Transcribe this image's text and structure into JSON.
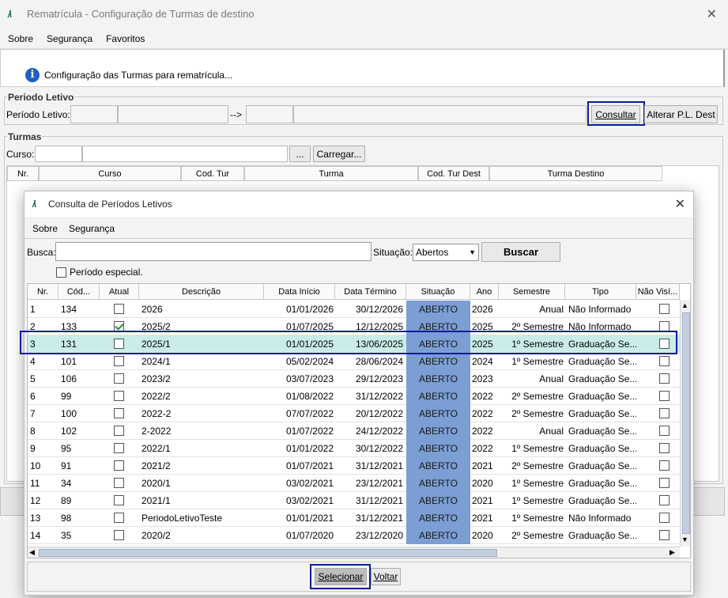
{
  "main": {
    "title": "Rematrícula - Configuração de Turmas de destino",
    "menu": [
      "Sobre",
      "Segurança",
      "Favoritos"
    ],
    "info": "Configuração das Turmas para rematrícula...",
    "periodo_group": "Periodo Letivo",
    "periodo_label": "Período Letivo:",
    "arrow": "-->",
    "consultar": "Consultar",
    "alterar": "Alterar P.L. Dest",
    "turmas_group": "Turmas",
    "curso_label": "Curso:",
    "ellipsis": "...",
    "carregar": "Carregar...",
    "columns": [
      "Nr.",
      "Curso",
      "Cod. Tur",
      "Turma",
      "Cod. Tur Dest",
      "Turma Destino"
    ]
  },
  "dialog": {
    "title": "Consulta de Períodos Letivos",
    "menu": [
      "Sobre",
      "Segurança"
    ],
    "busca_label": "Busca:",
    "busca_value": "",
    "situacao_label": "Situação:",
    "situacao_value": "Abertos",
    "buscar": "Buscar",
    "especial_label": "Período especial.",
    "columns": [
      "Nr.",
      "Cód...",
      "Atual",
      "Descrição",
      "Data Início",
      "Data Término",
      "Situação",
      "Ano",
      "Semestre",
      "Tipo",
      "Não Visí..."
    ],
    "rows": [
      {
        "nr": "1",
        "cod": "134",
        "atual": false,
        "desc": "2026",
        "ini": "01/01/2026",
        "fim": "30/12/2026",
        "sit": "ABERTO",
        "ano": "2026",
        "sem": "Anual",
        "tipo": "Não Informado"
      },
      {
        "nr": "2",
        "cod": "133",
        "atual": true,
        "desc": "2025/2",
        "ini": "01/07/2025",
        "fim": "12/12/2025",
        "sit": "ABERTO",
        "ano": "2025",
        "sem": "2º Semestre",
        "tipo": "Não Informado"
      },
      {
        "nr": "3",
        "cod": "131",
        "atual": false,
        "desc": "2025/1",
        "ini": "01/01/2025",
        "fim": "13/06/2025",
        "sit": "ABERTO",
        "ano": "2025",
        "sem": "1º Semestre",
        "tipo": "Graduação Se..."
      },
      {
        "nr": "4",
        "cod": "101",
        "atual": false,
        "desc": "2024/1",
        "ini": "05/02/2024",
        "fim": "28/06/2024",
        "sit": "ABERTO",
        "ano": "2024",
        "sem": "1º Semestre",
        "tipo": "Graduação Se..."
      },
      {
        "nr": "5",
        "cod": "106",
        "atual": false,
        "desc": "2023/2",
        "ini": "03/07/2023",
        "fim": "29/12/2023",
        "sit": "ABERTO",
        "ano": "2023",
        "sem": "Anual",
        "tipo": "Graduação Se..."
      },
      {
        "nr": "6",
        "cod": "99",
        "atual": false,
        "desc": "2022/2",
        "ini": "01/08/2022",
        "fim": "31/12/2022",
        "sit": "ABERTO",
        "ano": "2022",
        "sem": "2º Semestre",
        "tipo": "Graduação Se..."
      },
      {
        "nr": "7",
        "cod": "100",
        "atual": false,
        "desc": "2022-2",
        "ini": "07/07/2022",
        "fim": "20/12/2022",
        "sit": "ABERTO",
        "ano": "2022",
        "sem": "2º Semestre",
        "tipo": "Graduação Se..."
      },
      {
        "nr": "8",
        "cod": "102",
        "atual": false,
        "desc": "2-2022",
        "ini": "01/07/2022",
        "fim": "24/12/2022",
        "sit": "ABERTO",
        "ano": "2022",
        "sem": "Anual",
        "tipo": "Graduação Se..."
      },
      {
        "nr": "9",
        "cod": "95",
        "atual": false,
        "desc": "2022/1",
        "ini": "01/01/2022",
        "fim": "30/12/2022",
        "sit": "ABERTO",
        "ano": "2022",
        "sem": "1º Semestre",
        "tipo": "Graduação Se..."
      },
      {
        "nr": "10",
        "cod": "91",
        "atual": false,
        "desc": "2021/2",
        "ini": "01/07/2021",
        "fim": "31/12/2021",
        "sit": "ABERTO",
        "ano": "2021",
        "sem": "2º Semestre",
        "tipo": "Graduação Se..."
      },
      {
        "nr": "11",
        "cod": "34",
        "atual": false,
        "desc": "2020/1",
        "ini": "03/02/2021",
        "fim": "23/12/2021",
        "sit": "ABERTO",
        "ano": "2020",
        "sem": "1º Semestre",
        "tipo": "Graduação Se..."
      },
      {
        "nr": "12",
        "cod": "89",
        "atual": false,
        "desc": "2021/1",
        "ini": "03/02/2021",
        "fim": "31/12/2021",
        "sit": "ABERTO",
        "ano": "2021",
        "sem": "1º Semestre",
        "tipo": "Graduação Se..."
      },
      {
        "nr": "13",
        "cod": "98",
        "atual": false,
        "desc": "PeriodoLetivoTeste",
        "ini": "01/01/2021",
        "fim": "31/12/2021",
        "sit": "ABERTO",
        "ano": "2021",
        "sem": "1º Semestre",
        "tipo": "Não Informado"
      },
      {
        "nr": "14",
        "cod": "35",
        "atual": false,
        "desc": "2020/2",
        "ini": "01/07/2020",
        "fim": "23/12/2020",
        "sit": "ABERTO",
        "ano": "2020",
        "sem": "2º Semestre",
        "tipo": "Graduação Se..."
      }
    ],
    "selecionar": "Selecionar",
    "voltar": "Voltar"
  }
}
